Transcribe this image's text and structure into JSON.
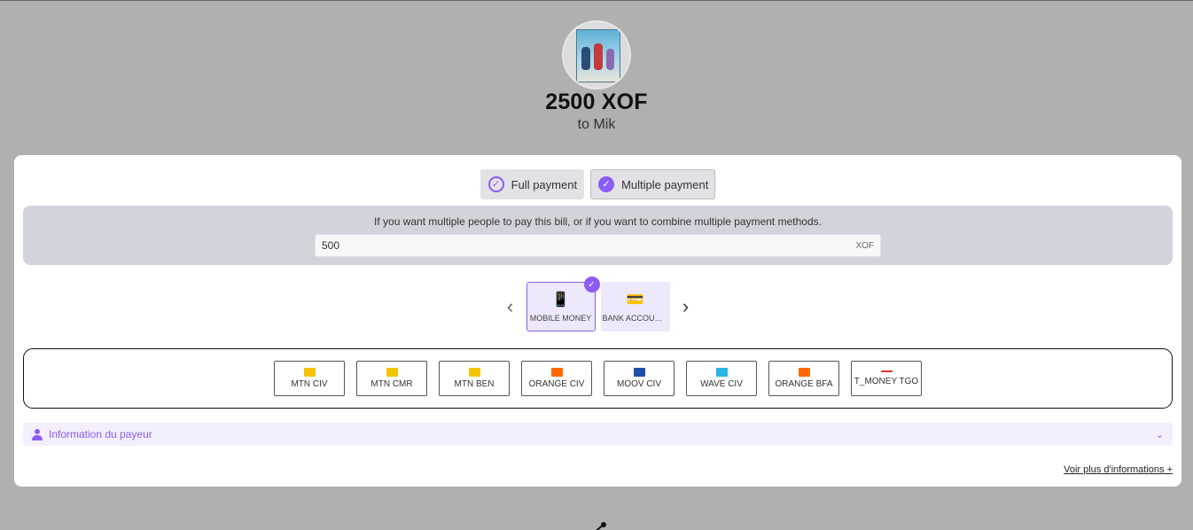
{
  "header": {
    "amount": "2500 XOF",
    "recipient": "to Mik"
  },
  "payment_modes": [
    {
      "label": "Full payment",
      "selected": false
    },
    {
      "label": "Multiple payment",
      "selected": true
    }
  ],
  "multi": {
    "description": "If you want multiple people to pay this bill, or if you want to combine multiple payment methods.",
    "amount_value": "500",
    "currency": "XOF"
  },
  "methods": [
    {
      "label": "MOBILE MONEY",
      "icon": "phone-icon",
      "selected": true
    },
    {
      "label": "BANK ACCOUNT...",
      "icon": "cards-icon",
      "selected": false
    }
  ],
  "providers": [
    {
      "label": "MTN CIV",
      "logo_color": "#f5c400"
    },
    {
      "label": "MTN CMR",
      "logo_color": "#f5c400"
    },
    {
      "label": "MTN BEN",
      "logo_color": "#f5c400"
    },
    {
      "label": "ORANGE CIV",
      "logo_color": "#ff6a00"
    },
    {
      "label": "MOOV CIV",
      "logo_color": "#1f4fa8"
    },
    {
      "label": "WAVE CIV",
      "logo_color": "#2bb6e6"
    },
    {
      "label": "ORANGE BFA",
      "logo_color": "#ff6a00"
    },
    {
      "label": "T_MONEY TGO",
      "logo_color": "#e03030"
    }
  ],
  "payer": {
    "label": "Information du payeur"
  },
  "more_link": "Voir plus d'informations +",
  "colors": {
    "accent": "#8b5cf6",
    "background": "#b0b0b0",
    "panel": "#d1d4db"
  }
}
